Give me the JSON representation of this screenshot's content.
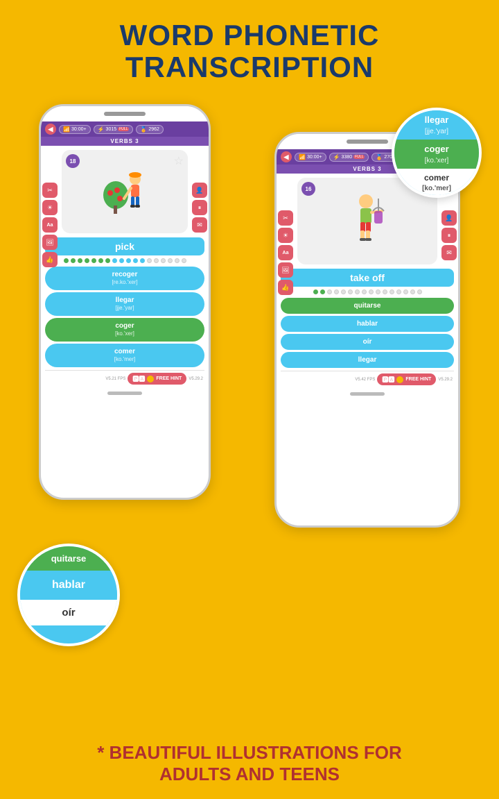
{
  "title": {
    "line1": "WORD PHONETIC",
    "line2": "TRANSCRIPTION"
  },
  "phone_left": {
    "status": {
      "time": "30:00+",
      "score": "3015",
      "score_label": "FULL",
      "coins": "2962"
    },
    "level": "VERBS 3",
    "card": {
      "number": "18",
      "word": "pick"
    },
    "dots": {
      "green": 7,
      "blue": 5,
      "empty": 6
    },
    "answers": [
      {
        "word": "recoger",
        "phonetic": "[re.ko.'xer]",
        "type": "blue"
      },
      {
        "word": "llegar",
        "phonetic": "[jje.'yar]",
        "type": "blue"
      },
      {
        "word": "coger",
        "phonetic": "[ko.'xer]",
        "type": "green"
      },
      {
        "word": "comer",
        "phonetic": "[ko.'mer]",
        "type": "blue"
      }
    ],
    "hint_label": "FREE HINT"
  },
  "phone_right": {
    "status": {
      "time": "30:00+",
      "score": "3380",
      "score_label": "FULL",
      "coins": "2702"
    },
    "level": "VERBS 3",
    "card": {
      "number": "16",
      "word": "take off"
    },
    "dots": {
      "green": 2,
      "blue": 0,
      "empty": 14
    },
    "answers": [
      {
        "word": "quitarse",
        "type": "green"
      },
      {
        "word": "hablar",
        "type": "blue"
      },
      {
        "word": "oír",
        "type": "blue"
      },
      {
        "word": "llegar",
        "type": "blue"
      }
    ],
    "hint_label": "FREE HINT"
  },
  "circle_right": {
    "items": [
      {
        "word": "llegar",
        "phonetic": "[jje.'yar]",
        "type": "blue"
      },
      {
        "word": "coger",
        "phonetic": "[ko.'xer]",
        "type": "green"
      },
      {
        "word": "comer",
        "phonetic": "[ko.'mer]",
        "type": "white"
      }
    ]
  },
  "circle_left": {
    "items": [
      {
        "word": "quitarse",
        "type": "green"
      },
      {
        "word": "hablar",
        "type": "blue"
      },
      {
        "word": "oír",
        "type": "white"
      }
    ]
  },
  "bottom_text": {
    "line1": "* BEAUTIFUL ILLUSTRATIONS FOR",
    "line2": "ADULTS AND TEENS"
  },
  "icons": {
    "back": "◀",
    "wifi": "📶",
    "bolt": "⚡",
    "coin": "🏅",
    "star": "☆",
    "cut": "✂",
    "sun": "☀",
    "text": "Aa",
    "image": "🖼",
    "thumb": "👍",
    "user": "👤",
    "pause": "⏸",
    "mail": "✉"
  }
}
